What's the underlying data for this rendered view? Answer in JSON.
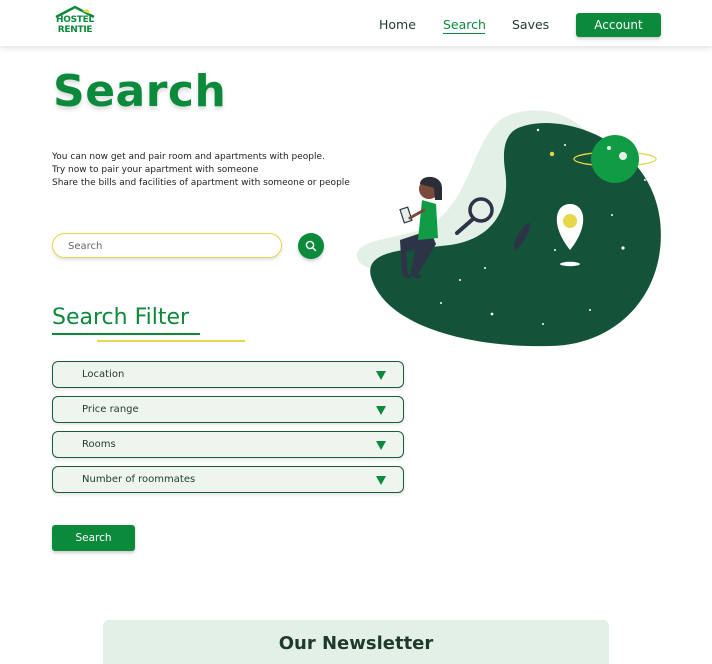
{
  "brand": {
    "line1": "HOSTEL",
    "line2": "RENTIE",
    "color": "#0a8a3a"
  },
  "nav": {
    "home": "Home",
    "search": "Search",
    "saves": "Saves",
    "account": "Account"
  },
  "hero": {
    "title": "Search",
    "lines": [
      "You can now get and pair room and apartments with people.",
      "Try now to pair your apartment with someone",
      "Share the bills and facilities of apartment with someone or people"
    ],
    "search_placeholder": "Search"
  },
  "filter": {
    "title": "Search Filter",
    "options": [
      "Location",
      "Price range",
      "Rooms",
      "Number of roommates"
    ],
    "button": "Search"
  },
  "newsletter": {
    "title": "Our Newsletter"
  },
  "colors": {
    "primary": "#0a8a3a",
    "dark_green": "#14533a",
    "accent_yellow": "#e6d84a",
    "pale_green": "#eef5ee"
  }
}
